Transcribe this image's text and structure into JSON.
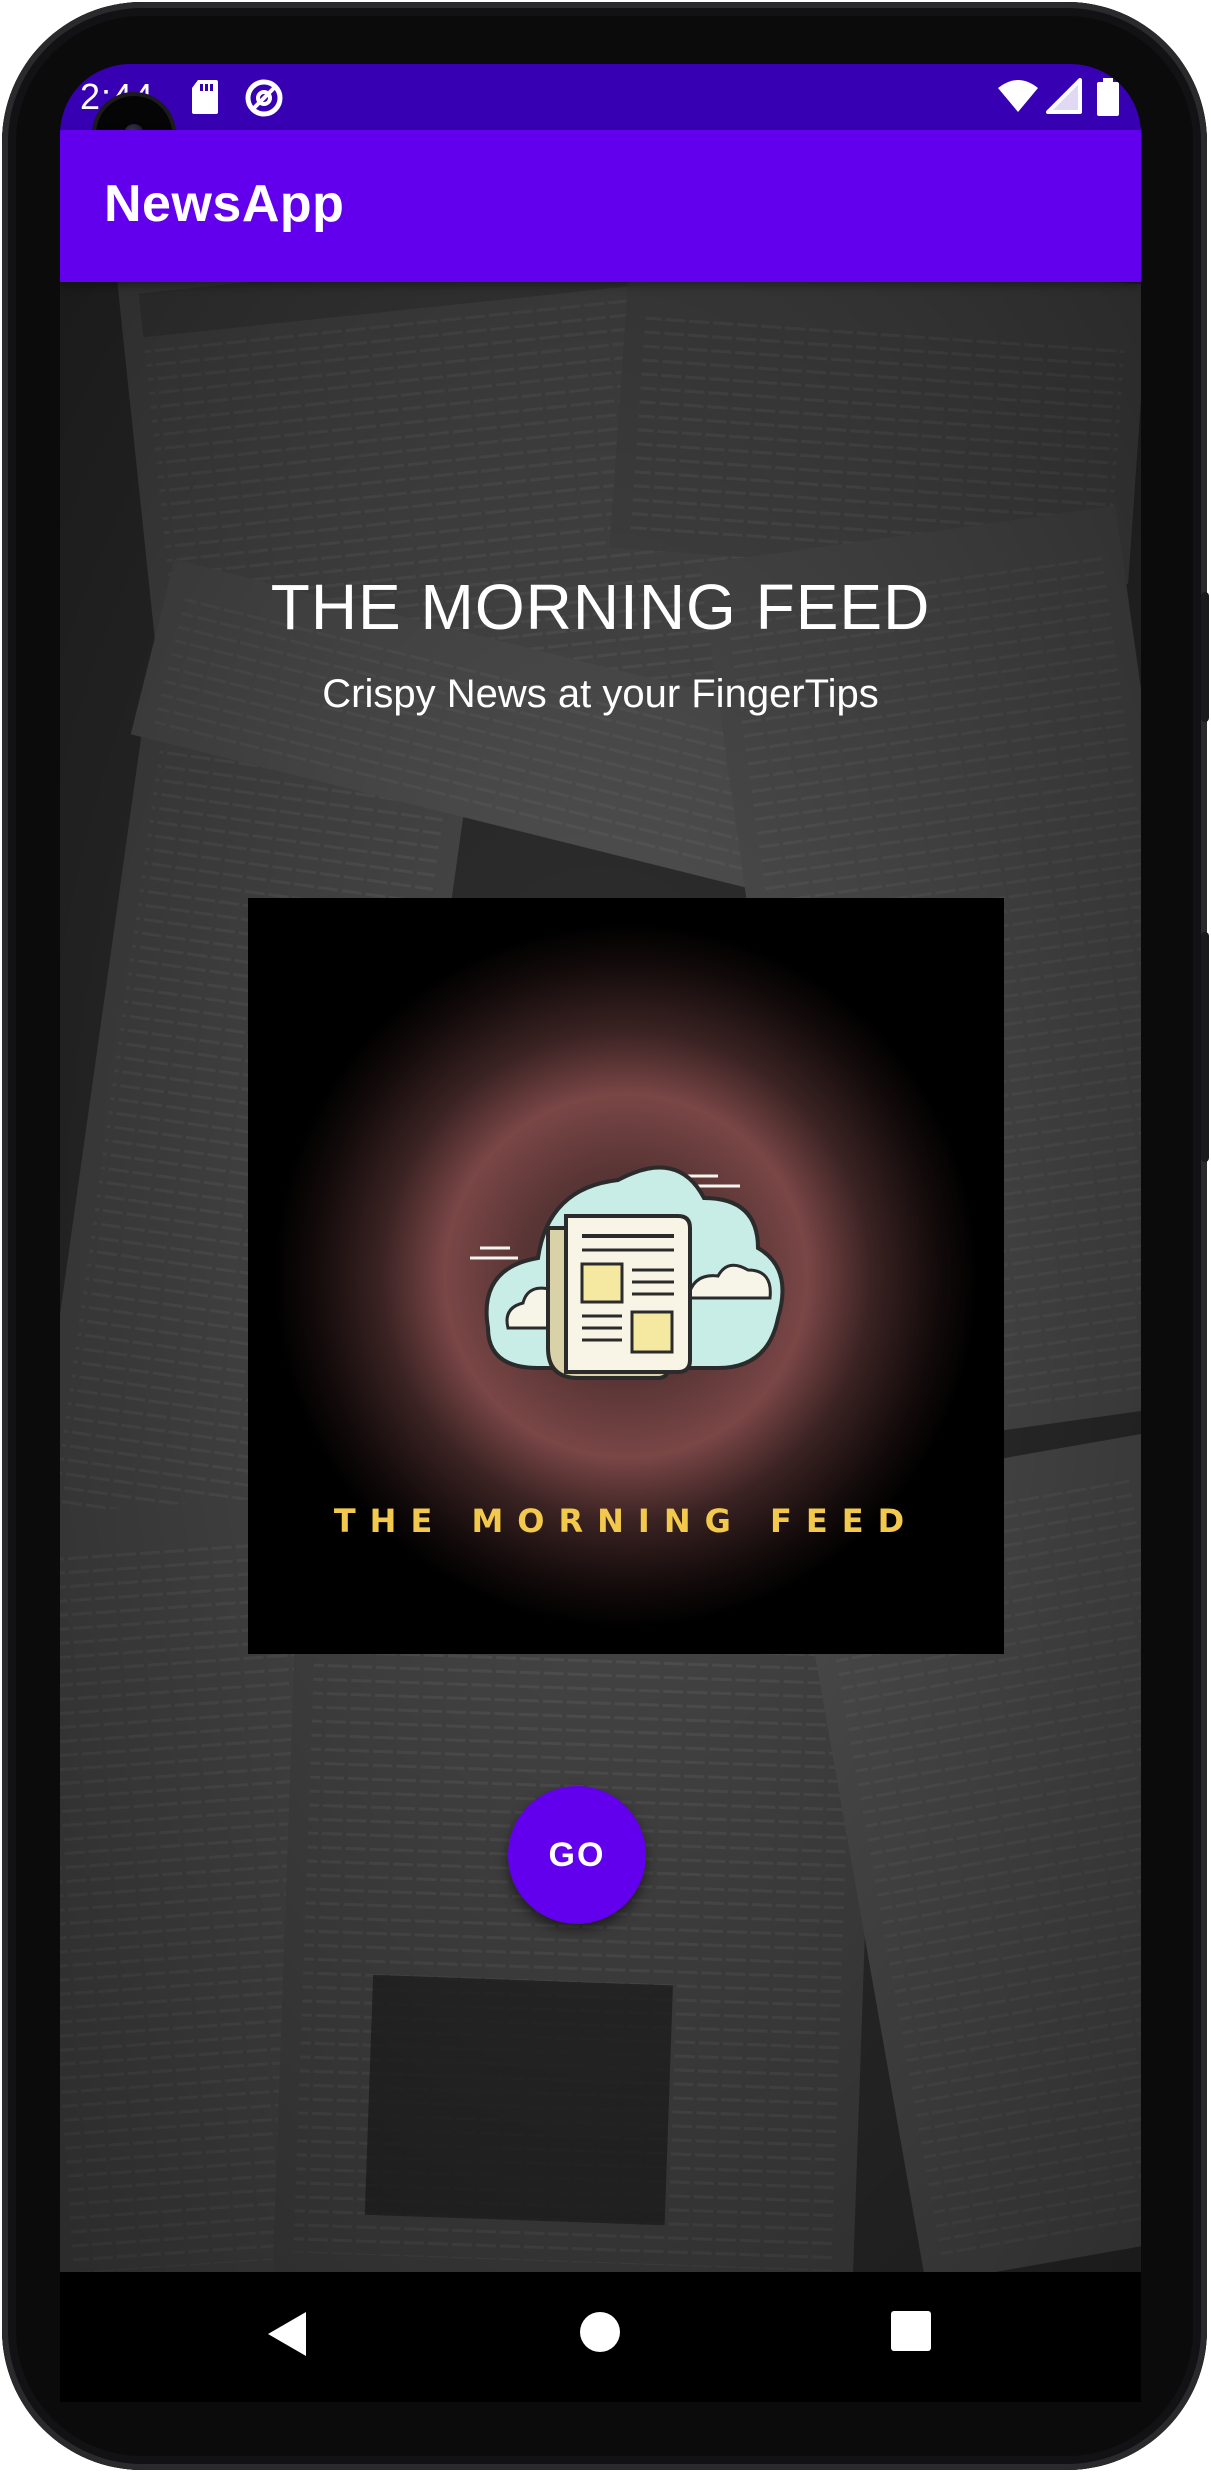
{
  "status_bar": {
    "time": "2:44",
    "icons": [
      "sd-card-icon",
      "do-not-disturb-icon",
      "wifi-icon",
      "cellular-signal-icon",
      "battery-icon"
    ]
  },
  "app_bar": {
    "title": "NewsApp"
  },
  "main": {
    "headline": "THE MORNING FEED",
    "subheadline": "Crispy News at your FingerTips",
    "logo": {
      "icon": "newspaper-cloud-icon",
      "wordmark": "THE MORNING FEED"
    },
    "go_button_label": "GO"
  },
  "nav_bar": {
    "icons": [
      "back-icon",
      "home-icon",
      "recents-icon"
    ]
  },
  "colors": {
    "status_bar": "#3700b3",
    "app_bar": "#6200ee",
    "accent_button": "#6200ee",
    "wordmark_gold": "#f2c94c"
  }
}
